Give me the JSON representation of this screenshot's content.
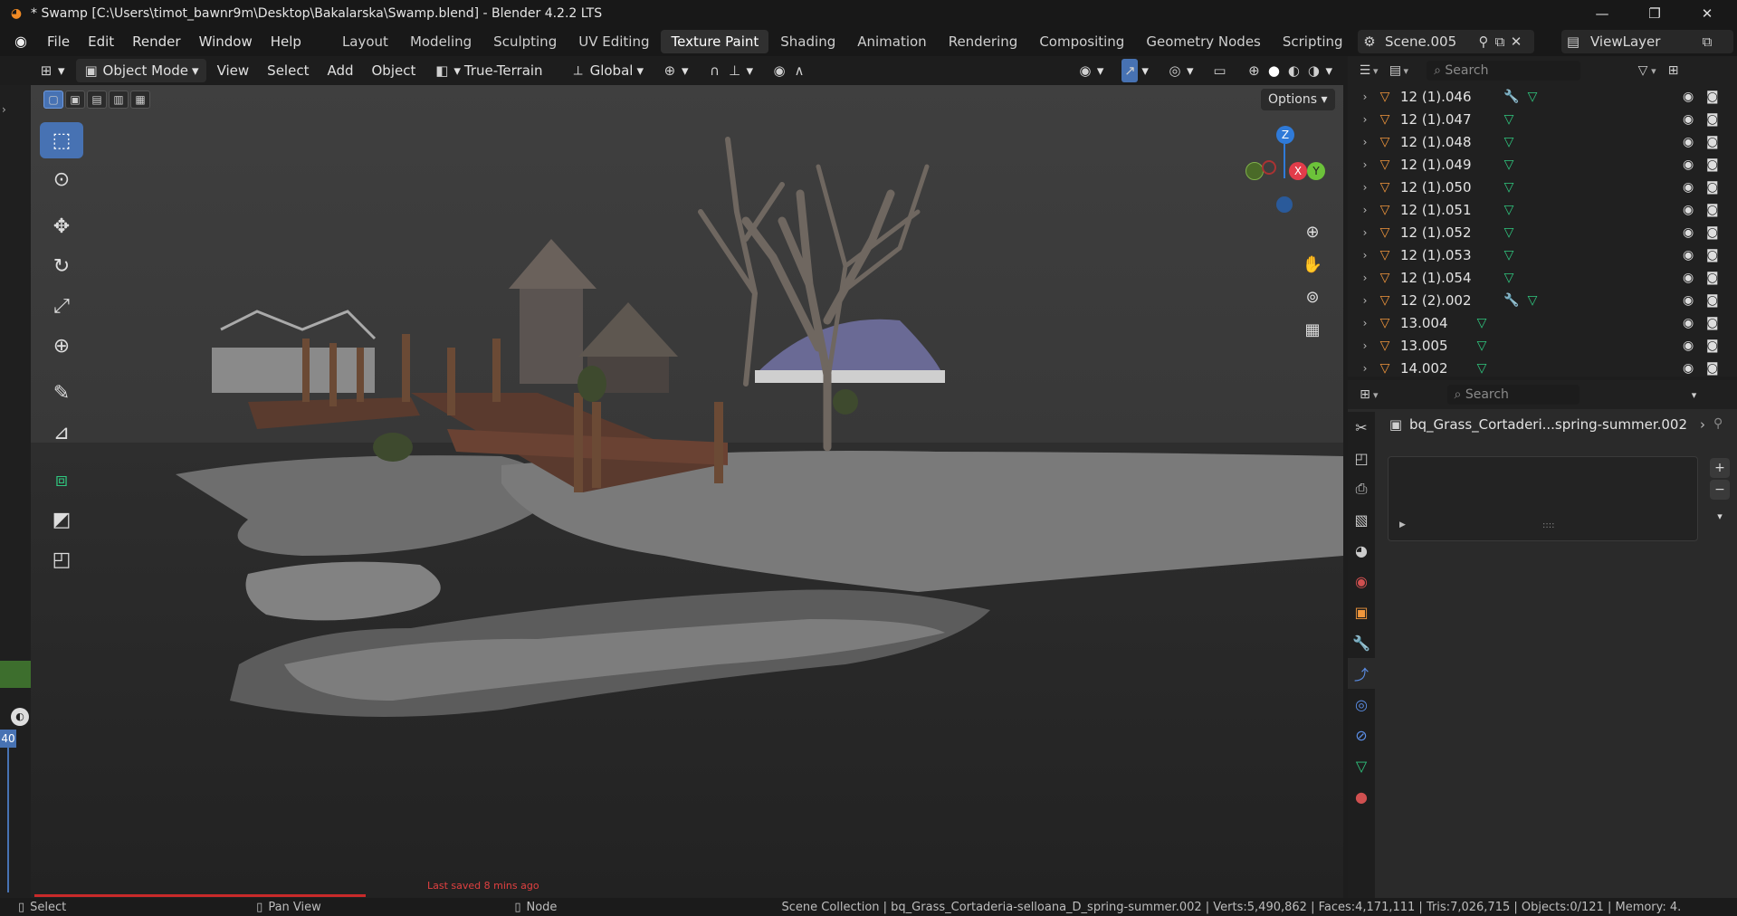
{
  "window": {
    "title": "* Swamp [C:\\Users\\timot_bawnr9m\\Desktop\\Bakalarska\\Swamp.blend] - Blender 4.2.2 LTS",
    "minimize": "—",
    "maximize": "❐",
    "close": "✕"
  },
  "menu": [
    "File",
    "Edit",
    "Render",
    "Window",
    "Help"
  ],
  "workspaces": [
    "Layout",
    "Modeling",
    "Sculpting",
    "UV Editing",
    "Texture Paint",
    "Shading",
    "Animation",
    "Rendering",
    "Compositing",
    "Geometry Nodes",
    "Scripting"
  ],
  "active_workspace": "Texture Paint",
  "scene": "Scene.005",
  "view_layer": "ViewLayer",
  "viewport_header": {
    "mode": "Object Mode",
    "view": "View",
    "select": "Select",
    "add": "Add",
    "object": "Object",
    "snap_target": "True-Terrain",
    "orientation": "Global",
    "options": "Options"
  },
  "gizmo": {
    "z": "Z",
    "x": "X",
    "y": "Y"
  },
  "outliner": {
    "search_placeholder": "Search",
    "rows": [
      {
        "name": "12 (1).046",
        "modifier": true
      },
      {
        "name": "12 (1).047",
        "modifier": false
      },
      {
        "name": "12 (1).048",
        "modifier": false
      },
      {
        "name": "12 (1).049",
        "modifier": false
      },
      {
        "name": "12 (1).050",
        "modifier": false
      },
      {
        "name": "12 (1).051",
        "modifier": false
      },
      {
        "name": "12 (1).052",
        "modifier": false
      },
      {
        "name": "12 (1).053",
        "modifier": false
      },
      {
        "name": "12 (1).054",
        "modifier": false
      },
      {
        "name": "12 (2).002",
        "modifier": true
      },
      {
        "name": "13.004",
        "modifier": false
      },
      {
        "name": "13.005",
        "modifier": false
      },
      {
        "name": "14.002",
        "modifier": false
      }
    ]
  },
  "properties": {
    "search_placeholder": "Search",
    "object_name": "bq_Grass_Cortaderi...spring-summer.002"
  },
  "timeline_frame": "40",
  "last_saved": "Last saved 8 mins ago",
  "status": {
    "select": "Select",
    "pan": "Pan View",
    "node": "Node",
    "info": "Scene Collection | bq_Grass_Cortaderia-selloana_D_spring-summer.002 | Verts:5,490,862 | Faces:4,171,111 | Tris:7,026,715 | Objects:0/121 | Memory: 4."
  },
  "colors": {
    "accent": "#4772b3",
    "mesh": "#2fc77f",
    "object": "#f0963c",
    "modifier": "#5b8ee6"
  }
}
